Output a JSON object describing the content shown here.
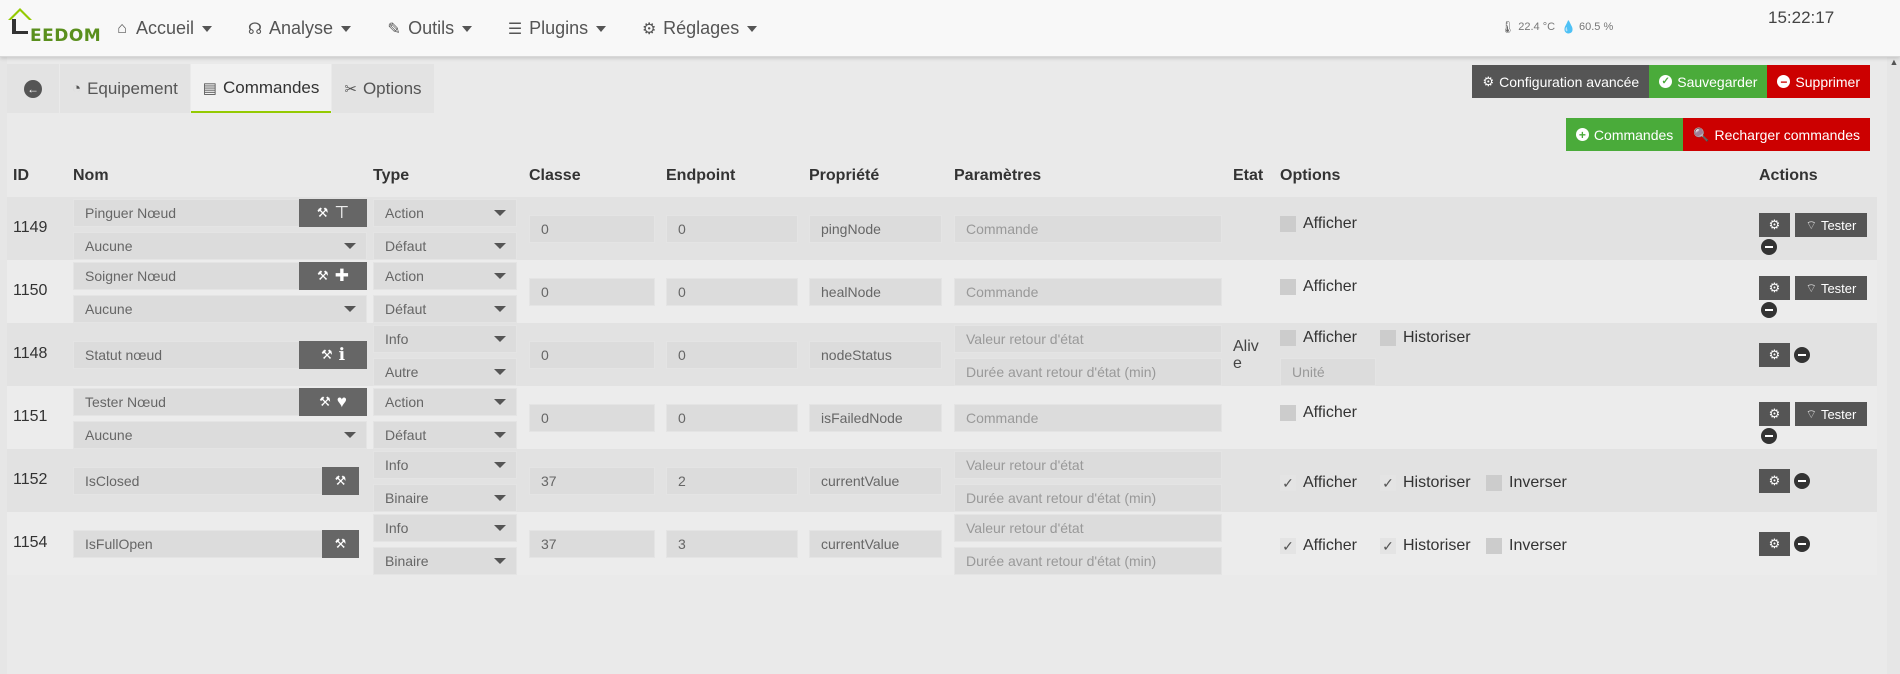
{
  "brand": {
    "name": "EEDOM",
    "accent": "#94ca02",
    "logo_icon": "house-logo-icon"
  },
  "nav": {
    "items": [
      {
        "label": "Accueil",
        "icon": "home-icon"
      },
      {
        "label": "Analyse",
        "icon": "stethoscope-icon"
      },
      {
        "label": "Outils",
        "icon": "wrench-icon"
      },
      {
        "label": "Plugins",
        "icon": "tasks-icon"
      },
      {
        "label": "Réglages",
        "icon": "cog-icon"
      }
    ],
    "temperature": "22.4 °C",
    "humidity": "60.5 %",
    "time": "15:22:17"
  },
  "tabs": {
    "back_icon": "arrow-circle-left-icon",
    "items": [
      {
        "label": "Equipement",
        "icon": "tachometer-icon"
      },
      {
        "label": "Commandes",
        "icon": "list-alt-icon",
        "active": true
      },
      {
        "label": "Options",
        "icon": "tools-icon"
      }
    ]
  },
  "top_actions": {
    "advanced": "Configuration avancée",
    "save": "Sauvegarder",
    "delete": "Supprimer"
  },
  "sub_actions": {
    "add": "Commandes",
    "reload": "Recharger commandes"
  },
  "table": {
    "headers": {
      "id": "ID",
      "nom": "Nom",
      "type": "Type",
      "classe": "Classe",
      "endpoint": "Endpoint",
      "propriete": "Propriété",
      "parametres": "Paramètres",
      "etat": "Etat",
      "options": "Options",
      "actions": "Actions"
    },
    "labels": {
      "afficher": "Afficher",
      "historiser": "Historiser",
      "inverser": "Inverser",
      "tester": "Tester",
      "commande_ph": "Commande",
      "valeur_ph": "Valeur retour d'état",
      "duree_ph": "Durée avant retour d'état (min)",
      "unite_ph": "Unité"
    },
    "rows": [
      {
        "id": "1149",
        "nom": "Pinguer Nœud",
        "value": "Aucune",
        "type": "Action",
        "subtype": "Défaut",
        "classe": "0",
        "endpoint": "0",
        "propriete": "pingNode",
        "etat": "",
        "icon": "sitemap-icon",
        "afficher": false,
        "historiser": null,
        "inverser": null
      },
      {
        "id": "1150",
        "nom": "Soigner Nœud",
        "value": "Aucune",
        "type": "Action",
        "subtype": "Défaut",
        "classe": "0",
        "endpoint": "0",
        "propriete": "healNode",
        "etat": "",
        "icon": "medkit-icon",
        "afficher": false,
        "historiser": null,
        "inverser": null
      },
      {
        "id": "1148",
        "nom": "Statut nœud",
        "value": "",
        "type": "Info",
        "subtype": "Autre",
        "classe": "0",
        "endpoint": "0",
        "propriete": "nodeStatus",
        "etat": "Alive",
        "icon": "info-icon",
        "afficher": false,
        "historiser": false,
        "inverser": null
      },
      {
        "id": "1151",
        "nom": "Tester Nœud",
        "value": "Aucune",
        "type": "Action",
        "subtype": "Défaut",
        "classe": "0",
        "endpoint": "0",
        "propriete": "isFailedNode",
        "etat": "",
        "icon": "heartbeat-icon",
        "afficher": false,
        "historiser": null,
        "inverser": null
      },
      {
        "id": "1152",
        "nom": "IsClosed",
        "value": "",
        "type": "Info",
        "subtype": "Binaire",
        "classe": "37",
        "endpoint": "2",
        "propriete": "currentValue",
        "etat": "",
        "icon": "",
        "afficher": true,
        "historiser": true,
        "inverser": false
      },
      {
        "id": "1154",
        "nom": "IsFullOpen",
        "value": "",
        "type": "Info",
        "subtype": "Binaire",
        "classe": "37",
        "endpoint": "3",
        "propriete": "currentValue",
        "etat": "",
        "icon": "",
        "afficher": true,
        "historiser": true,
        "inverser": false
      }
    ]
  }
}
